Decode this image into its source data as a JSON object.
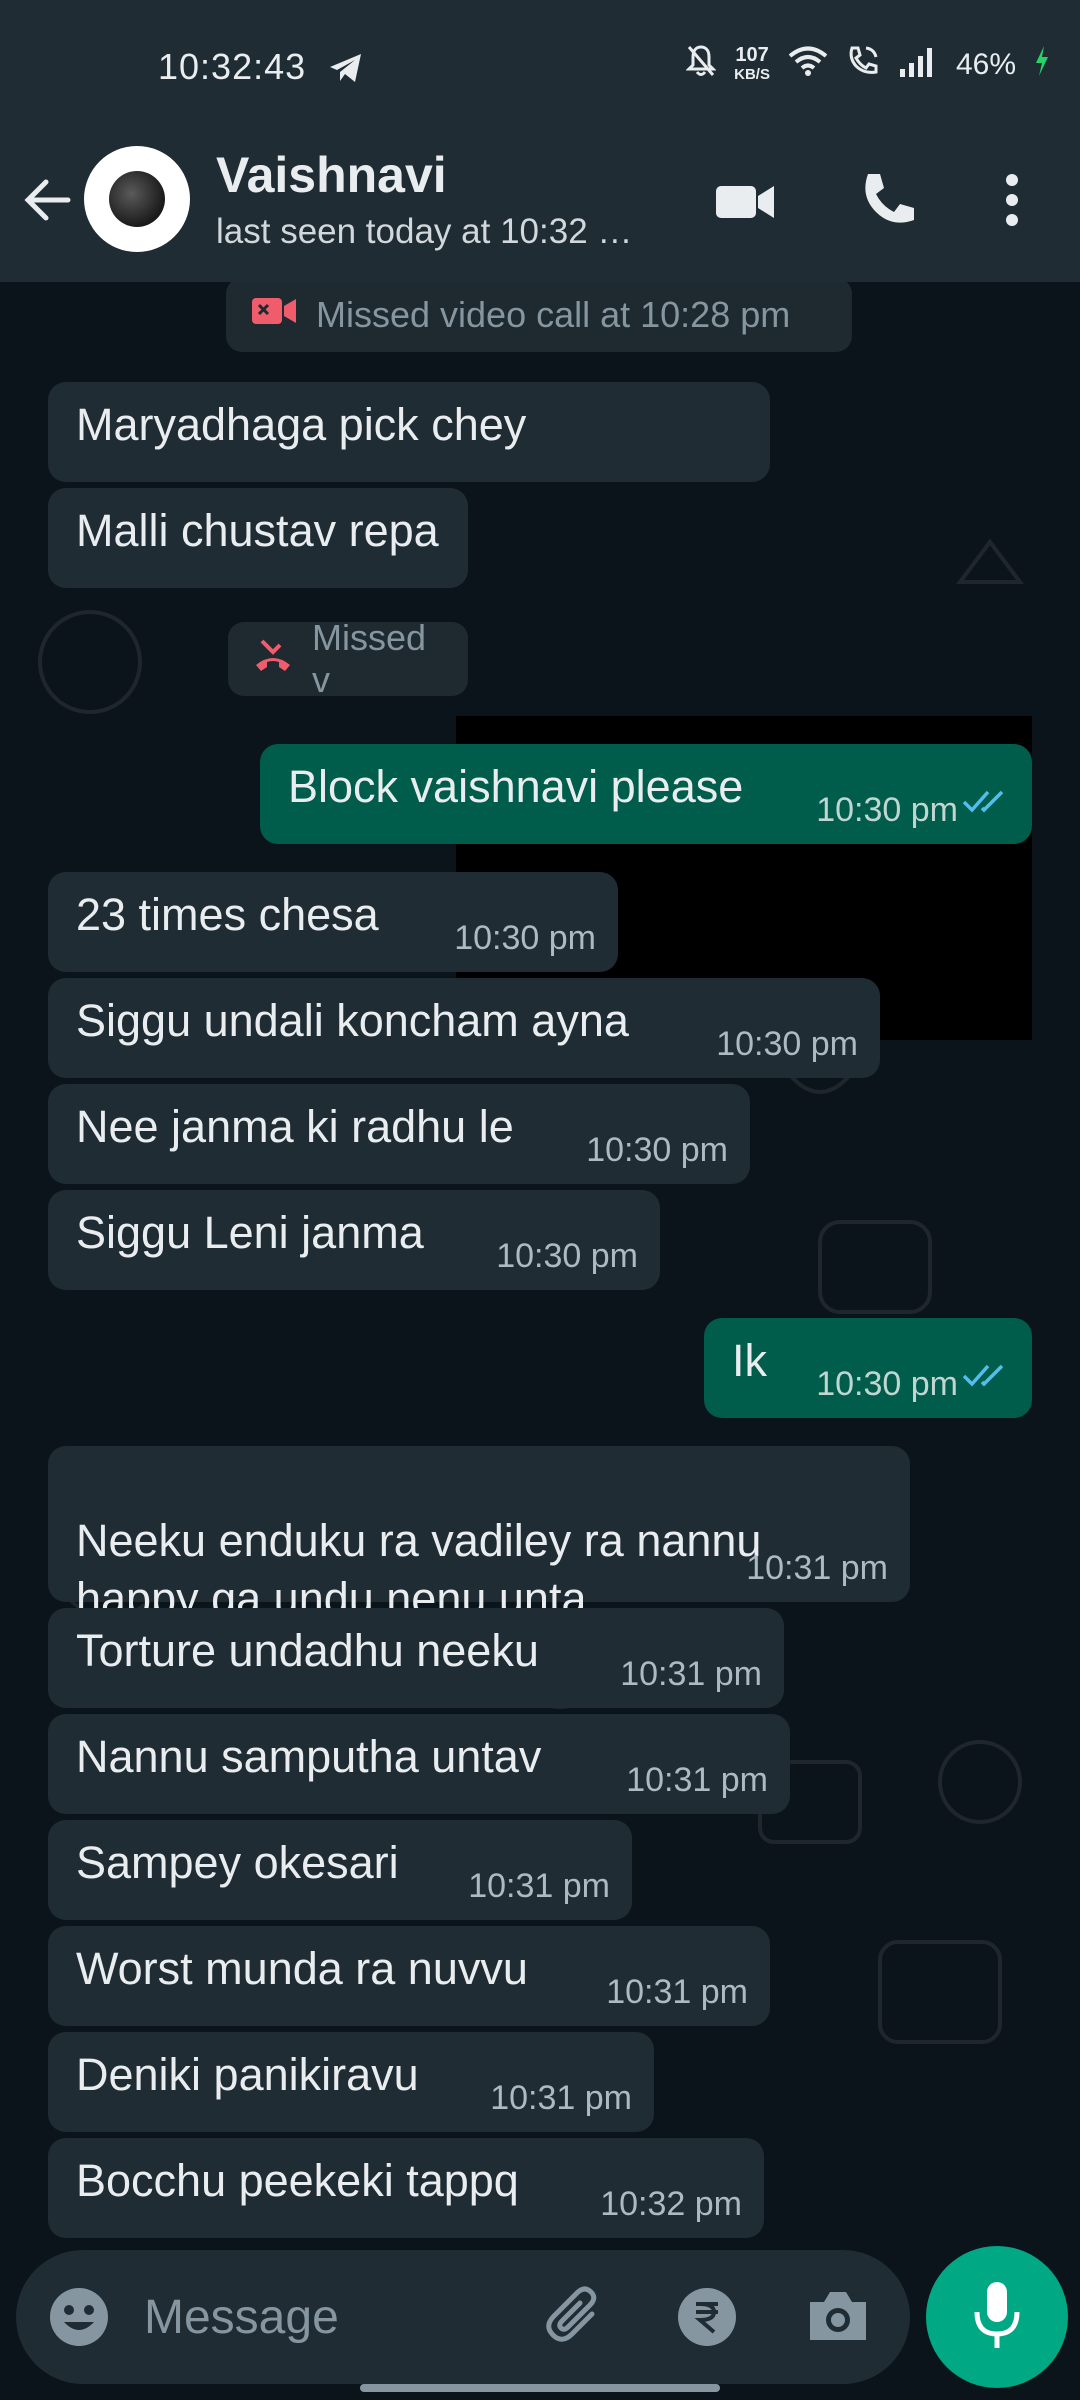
{
  "status_bar": {
    "time": "10:32:43",
    "speed_value": "107",
    "speed_unit": "KB/S",
    "battery": "46%"
  },
  "header": {
    "contact_name": "Vaishnavi",
    "last_seen": "last seen today at 10:32 …"
  },
  "system_messages": {
    "missed_video": "Missed video call at 10:28 pm",
    "missed_voice_partial": "Missed v"
  },
  "messages": [
    {
      "text": "Maryadhaga pick chey",
      "time": ""
    },
    {
      "text": "Malli chustav repa",
      "time": ""
    },
    {
      "text": "Block vaishnavi please",
      "time": "10:30 pm"
    },
    {
      "text": "23 times chesa",
      "time": "10:30 pm"
    },
    {
      "text": "Siggu undali koncham ayna",
      "time": "10:30 pm"
    },
    {
      "text": "Nee janma ki radhu le",
      "time": "10:30 pm"
    },
    {
      "text": "Siggu Leni janma",
      "time": "10:30 pm"
    },
    {
      "text": "Ik",
      "time": "10:30 pm"
    },
    {
      "text": "Neeku enduku ra vadiley ra nannu\nhappy ga undu nenu unta",
      "time": "10:31 pm"
    },
    {
      "text": "Torture undadhu neeku",
      "time": "10:31 pm"
    },
    {
      "text": "Nannu samputha untav",
      "time": "10:31 pm"
    },
    {
      "text": "Sampey okesari",
      "time": "10:31 pm"
    },
    {
      "text": "Worst munda ra nuvvu",
      "time": "10:31 pm"
    },
    {
      "text": "Deniki panikiravu",
      "time": "10:31 pm"
    },
    {
      "text": "Bocchu peekeki tappq",
      "time": "10:32 pm"
    }
  ],
  "input": {
    "placeholder": "Message"
  },
  "colors": {
    "header_bg": "#1f2c34",
    "chat_bg": "#0b141a",
    "incoming_bubble": "#202c33",
    "outgoing_bubble": "#005c4b",
    "accent": "#00a884",
    "read_ticks": "#53bdeb",
    "missed_call_red": "#f15c6d"
  },
  "icons": [
    "telegram-icon",
    "mute-icon",
    "wifi-icon",
    "wifi-calling-icon",
    "signal-icon",
    "charging-icon",
    "back-arrow-icon",
    "video-call-icon",
    "voice-call-icon",
    "more-options-icon",
    "missed-video-call-icon",
    "missed-voice-call-icon",
    "read-ticks-icon",
    "emoji-icon",
    "attach-icon",
    "rupee-payment-icon",
    "camera-icon",
    "mic-icon"
  ]
}
